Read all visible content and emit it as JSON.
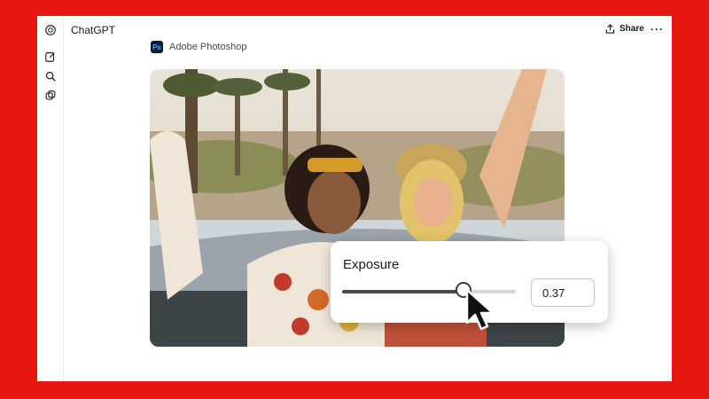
{
  "app": {
    "title": "ChatGPT"
  },
  "header": {
    "share_label": "Share",
    "more_label": "···"
  },
  "rail": {
    "icons": [
      "openai-logo-icon",
      "new-chat-icon",
      "search-icon",
      "library-icon"
    ]
  },
  "attachment": {
    "app_name": "Adobe Photoshop",
    "logo_text": "Ps"
  },
  "exposure": {
    "title": "Exposure",
    "value": "0.37",
    "slider_fraction": 0.7
  },
  "colors": {
    "background": "#e8170f",
    "ps_logo_bg": "#001e36",
    "ps_logo_fg": "#31a8ff"
  }
}
